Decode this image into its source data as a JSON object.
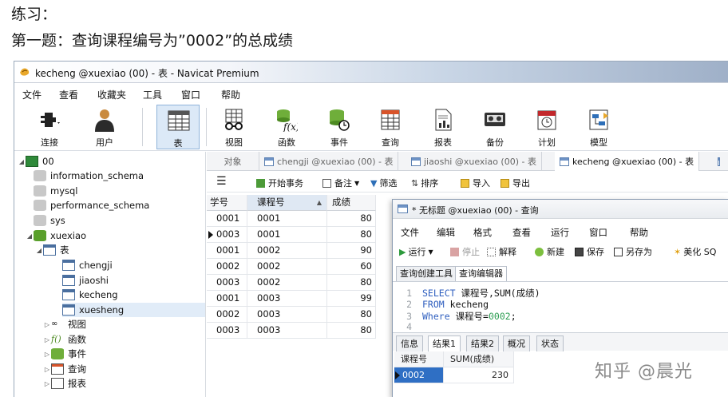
{
  "doc": {
    "line1": "练习：",
    "line2": "第一题：查询课程编号为”0002”的总成绩"
  },
  "window": {
    "title": "kecheng @xuexiao (00) - 表 - Navicat Premium",
    "menu": [
      "文件",
      "查看",
      "收藏夹",
      "工具",
      "窗口",
      "帮助"
    ]
  },
  "toolbar": {
    "tools": [
      {
        "label": "连接",
        "icon": "plug-icon"
      },
      {
        "label": "用户",
        "icon": "user-icon"
      },
      {
        "label": "表",
        "icon": "table-icon",
        "active": true
      },
      {
        "label": "视图",
        "icon": "view-glasses-icon"
      },
      {
        "label": "函数",
        "icon": "function-icon"
      },
      {
        "label": "事件",
        "icon": "event-clock-icon"
      },
      {
        "label": "查询",
        "icon": "query-icon"
      },
      {
        "label": "报表",
        "icon": "report-icon"
      },
      {
        "label": "备份",
        "icon": "backup-tape-icon"
      },
      {
        "label": "计划",
        "icon": "schedule-calendar-icon"
      },
      {
        "label": "模型",
        "icon": "model-icon"
      }
    ]
  },
  "tree": {
    "connection": "00",
    "databases": [
      "information_schema",
      "mysql",
      "performance_schema",
      "sys"
    ],
    "open_db": "xuexiao",
    "tables_label": "表",
    "tables": [
      "chengji",
      "jiaoshi",
      "kecheng",
      "xuesheng"
    ],
    "folders": [
      "视图",
      "函数",
      "事件",
      "查询",
      "报表"
    ]
  },
  "object_tabs": [
    "对象",
    "chengji @xuexiao (00) - 表",
    "jiaoshi @xuexiao (00) - 表",
    "kecheng @xuexiao (00) - 表"
  ],
  "table_toolbar": {
    "begin_tx": "开始事务",
    "note": "备注",
    "filter": "筛选",
    "sort": "排序",
    "import": "导入",
    "export": "导出"
  },
  "grid": {
    "columns": [
      "学号",
      "课程号",
      "成绩"
    ],
    "rows": [
      [
        "0001",
        "0001",
        "80"
      ],
      [
        "0003",
        "0001",
        "80"
      ],
      [
        "0001",
        "0002",
        "90"
      ],
      [
        "0002",
        "0002",
        "60"
      ],
      [
        "0003",
        "0002",
        "80"
      ],
      [
        "0001",
        "0003",
        "99"
      ],
      [
        "0002",
        "0003",
        "80"
      ],
      [
        "0003",
        "0003",
        "80"
      ]
    ]
  },
  "query_window": {
    "title": "* 无标题 @xuexiao (00) - 查询",
    "menu": [
      "文件",
      "编辑",
      "格式",
      "查看",
      "运行",
      "窗口",
      "帮助"
    ],
    "toolbar": {
      "run": "运行",
      "stop": "停止",
      "explain": "解释",
      "new": "新建",
      "save": "保存",
      "save_as": "另存为",
      "beautify": "美化 SQ"
    },
    "editor_tabs": [
      "查询创建工具",
      "查询编辑器"
    ],
    "code": {
      "l1_kw": "SELECT",
      "l1_rest": "课程号,SUM(成绩)",
      "l2_kw": "FROM",
      "l2_rest": "kecheng",
      "l3_kw": "Where",
      "l3_rest": "课程号=",
      "l3_num": "0002",
      "l3_end": ";"
    },
    "line_numbers": [
      "1",
      "2",
      "3",
      "4"
    ],
    "result_tabs": [
      "信息",
      "结果1",
      "结果2",
      "概况",
      "状态"
    ],
    "result": {
      "columns": [
        "课程号",
        "SUM(成绩)"
      ],
      "row": [
        "0002",
        "230"
      ]
    }
  },
  "watermark": "知乎 @晨光"
}
